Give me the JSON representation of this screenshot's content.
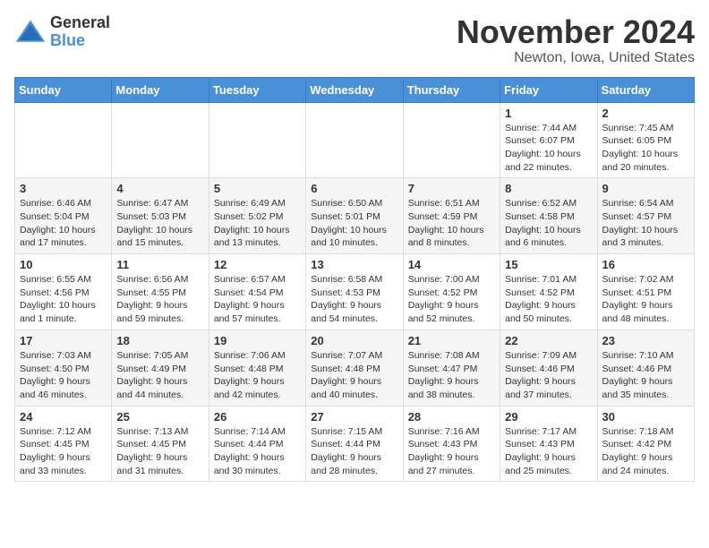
{
  "header": {
    "logo_general": "General",
    "logo_blue": "Blue",
    "month_title": "November 2024",
    "location": "Newton, Iowa, United States"
  },
  "days_of_week": [
    "Sunday",
    "Monday",
    "Tuesday",
    "Wednesday",
    "Thursday",
    "Friday",
    "Saturday"
  ],
  "weeks": [
    [
      {
        "day": "",
        "sunrise": "",
        "sunset": "",
        "daylight": ""
      },
      {
        "day": "",
        "sunrise": "",
        "sunset": "",
        "daylight": ""
      },
      {
        "day": "",
        "sunrise": "",
        "sunset": "",
        "daylight": ""
      },
      {
        "day": "",
        "sunrise": "",
        "sunset": "",
        "daylight": ""
      },
      {
        "day": "",
        "sunrise": "",
        "sunset": "",
        "daylight": ""
      },
      {
        "day": "1",
        "sunrise": "Sunrise: 7:44 AM",
        "sunset": "Sunset: 6:07 PM",
        "daylight": "Daylight: 10 hours and 22 minutes."
      },
      {
        "day": "2",
        "sunrise": "Sunrise: 7:45 AM",
        "sunset": "Sunset: 6:05 PM",
        "daylight": "Daylight: 10 hours and 20 minutes."
      }
    ],
    [
      {
        "day": "3",
        "sunrise": "Sunrise: 6:46 AM",
        "sunset": "Sunset: 5:04 PM",
        "daylight": "Daylight: 10 hours and 17 minutes."
      },
      {
        "day": "4",
        "sunrise": "Sunrise: 6:47 AM",
        "sunset": "Sunset: 5:03 PM",
        "daylight": "Daylight: 10 hours and 15 minutes."
      },
      {
        "day": "5",
        "sunrise": "Sunrise: 6:49 AM",
        "sunset": "Sunset: 5:02 PM",
        "daylight": "Daylight: 10 hours and 13 minutes."
      },
      {
        "day": "6",
        "sunrise": "Sunrise: 6:50 AM",
        "sunset": "Sunset: 5:01 PM",
        "daylight": "Daylight: 10 hours and 10 minutes."
      },
      {
        "day": "7",
        "sunrise": "Sunrise: 6:51 AM",
        "sunset": "Sunset: 4:59 PM",
        "daylight": "Daylight: 10 hours and 8 minutes."
      },
      {
        "day": "8",
        "sunrise": "Sunrise: 6:52 AM",
        "sunset": "Sunset: 4:58 PM",
        "daylight": "Daylight: 10 hours and 6 minutes."
      },
      {
        "day": "9",
        "sunrise": "Sunrise: 6:54 AM",
        "sunset": "Sunset: 4:57 PM",
        "daylight": "Daylight: 10 hours and 3 minutes."
      }
    ],
    [
      {
        "day": "10",
        "sunrise": "Sunrise: 6:55 AM",
        "sunset": "Sunset: 4:56 PM",
        "daylight": "Daylight: 10 hours and 1 minute."
      },
      {
        "day": "11",
        "sunrise": "Sunrise: 6:56 AM",
        "sunset": "Sunset: 4:55 PM",
        "daylight": "Daylight: 9 hours and 59 minutes."
      },
      {
        "day": "12",
        "sunrise": "Sunrise: 6:57 AM",
        "sunset": "Sunset: 4:54 PM",
        "daylight": "Daylight: 9 hours and 57 minutes."
      },
      {
        "day": "13",
        "sunrise": "Sunrise: 6:58 AM",
        "sunset": "Sunset: 4:53 PM",
        "daylight": "Daylight: 9 hours and 54 minutes."
      },
      {
        "day": "14",
        "sunrise": "Sunrise: 7:00 AM",
        "sunset": "Sunset: 4:52 PM",
        "daylight": "Daylight: 9 hours and 52 minutes."
      },
      {
        "day": "15",
        "sunrise": "Sunrise: 7:01 AM",
        "sunset": "Sunset: 4:52 PM",
        "daylight": "Daylight: 9 hours and 50 minutes."
      },
      {
        "day": "16",
        "sunrise": "Sunrise: 7:02 AM",
        "sunset": "Sunset: 4:51 PM",
        "daylight": "Daylight: 9 hours and 48 minutes."
      }
    ],
    [
      {
        "day": "17",
        "sunrise": "Sunrise: 7:03 AM",
        "sunset": "Sunset: 4:50 PM",
        "daylight": "Daylight: 9 hours and 46 minutes."
      },
      {
        "day": "18",
        "sunrise": "Sunrise: 7:05 AM",
        "sunset": "Sunset: 4:49 PM",
        "daylight": "Daylight: 9 hours and 44 minutes."
      },
      {
        "day": "19",
        "sunrise": "Sunrise: 7:06 AM",
        "sunset": "Sunset: 4:48 PM",
        "daylight": "Daylight: 9 hours and 42 minutes."
      },
      {
        "day": "20",
        "sunrise": "Sunrise: 7:07 AM",
        "sunset": "Sunset: 4:48 PM",
        "daylight": "Daylight: 9 hours and 40 minutes."
      },
      {
        "day": "21",
        "sunrise": "Sunrise: 7:08 AM",
        "sunset": "Sunset: 4:47 PM",
        "daylight": "Daylight: 9 hours and 38 minutes."
      },
      {
        "day": "22",
        "sunrise": "Sunrise: 7:09 AM",
        "sunset": "Sunset: 4:46 PM",
        "daylight": "Daylight: 9 hours and 37 minutes."
      },
      {
        "day": "23",
        "sunrise": "Sunrise: 7:10 AM",
        "sunset": "Sunset: 4:46 PM",
        "daylight": "Daylight: 9 hours and 35 minutes."
      }
    ],
    [
      {
        "day": "24",
        "sunrise": "Sunrise: 7:12 AM",
        "sunset": "Sunset: 4:45 PM",
        "daylight": "Daylight: 9 hours and 33 minutes."
      },
      {
        "day": "25",
        "sunrise": "Sunrise: 7:13 AM",
        "sunset": "Sunset: 4:45 PM",
        "daylight": "Daylight: 9 hours and 31 minutes."
      },
      {
        "day": "26",
        "sunrise": "Sunrise: 7:14 AM",
        "sunset": "Sunset: 4:44 PM",
        "daylight": "Daylight: 9 hours and 30 minutes."
      },
      {
        "day": "27",
        "sunrise": "Sunrise: 7:15 AM",
        "sunset": "Sunset: 4:44 PM",
        "daylight": "Daylight: 9 hours and 28 minutes."
      },
      {
        "day": "28",
        "sunrise": "Sunrise: 7:16 AM",
        "sunset": "Sunset: 4:43 PM",
        "daylight": "Daylight: 9 hours and 27 minutes."
      },
      {
        "day": "29",
        "sunrise": "Sunrise: 7:17 AM",
        "sunset": "Sunset: 4:43 PM",
        "daylight": "Daylight: 9 hours and 25 minutes."
      },
      {
        "day": "30",
        "sunrise": "Sunrise: 7:18 AM",
        "sunset": "Sunset: 4:42 PM",
        "daylight": "Daylight: 9 hours and 24 minutes."
      }
    ]
  ]
}
